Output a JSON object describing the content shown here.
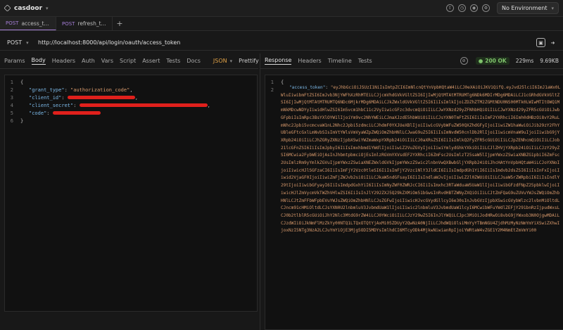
{
  "app": {
    "title": "casdoor"
  },
  "environment": {
    "label": "No Environment"
  },
  "tabs": [
    {
      "method": "POST",
      "name": "access_t..."
    },
    {
      "method": "POST",
      "name": "refresh_t..."
    }
  ],
  "tab_add": "+",
  "request": {
    "method": "POST",
    "url": "http://localhost:8000/api/login/oauth/access_token"
  },
  "request_tabs": [
    "Params",
    "Body",
    "Headers",
    "Auth",
    "Vars",
    "Script",
    "Assert",
    "Tests",
    "Docs"
  ],
  "body_mode": "JSON",
  "prettify": "Prettify",
  "body_lines": [
    {
      "n": "1",
      "t": "{"
    },
    {
      "n": "2",
      "key": "\"grant_type\"",
      "val": "\"authorization_code\""
    },
    {
      "n": "3",
      "key": "\"client_id\""
    },
    {
      "n": "4",
      "key": "\"client_secret\""
    },
    {
      "n": "5",
      "key": "\"code\""
    },
    {
      "n": "6",
      "t": "}"
    }
  ],
  "response_tabs": [
    "Response",
    "Headers",
    "Timeline",
    "Tests"
  ],
  "status": {
    "text": "200 OK",
    "time": "229ms",
    "size": "9.69KB",
    "color": "#7fc36b"
  },
  "response": {
    "line1": "{",
    "key": "\"access_token\"",
    "token": "\"eyJhbGciOiJSUzI1NiIsImtpZCI6ImNlcnQtYnVpbHQtaW4iLCJ0eXAiOiJKV1QifQ.eyJvd25lciI6ImJ1aWx0LWluIiwibmFtZSI6ImJvb3NjYWFhXzRhMTEiLCJjcmVhdGVkVGltZSI6IjIwMjQtMTAtMTRUMTg6NDk6MDIrMDg6MDAiLCJ1cGRhdGVkVGltZSI6IjIwMjQtMTAtMTRUMTQ6NDc6MjkrMDg6MDAiLCJkZWxldGVkVGltZSI6IiIsImlkIjoiZDZhZTM2ZGMtNDU0NS00MTk0LWIwMTItOWQ1MmNkMDcwNDYyIiwidHlwZSI6Im5vcm1hbC11c2VyIiwicGFzc3dvcmQiOiIiLCJwYXNzd29yZFNhbHQiOiIiLCJwYXNzd29yZFR5cGUiOiJwbGFpbiIsImRpc3BsYXlOYW1lIjoiYm9vc2NhYWEiLCJmaXJzdE5hbWUiOiIiLCJsYXN0TmFtZSI6IiIsImF2YXRhciI6Imh0dHBzOi8vY2RuLmNhc2Jpbi5vcmcvaW1nL2Nhc2Jpbi5zdmciLCJhdmF0YXJUeXBlIjoiIiwicGVybWFuZW50QXZhdGFyIjoiIiwiZW1haWwiOiJib29zY2FhYUBleGFtcGxlLmNvbSIsImVtYWlsVmVyaWZpZWQiOmZhbHNlLCJwaG9uZSI6IiIsImNvdW50cnlDb2RlIjoiIiwicmVnaW9uIjoiIiwibG9jYXRpb24iOiIiLCJhZGRyZXNzIjpbXSwiYWZmaWxpYXRpb24iOiIiLCJ0aXRsZSI6IiIsImlkQ2FyZFR5cGUiOiIiLCJpZENhcmQiOiIiLCJob21lcGFnZSI6IiIsImJpbyI6IiIsImxhbmd1YWdlIjoiIiwiZ2VuZGVyIjoiIiwiYmlydGhkYXkiOiIiLCJlZHVjYXRpb24iOiIiLCJzY29yZSI6MCwia2FybWEiOjAsInJhbmtpbmciOjEsImlzRGVmYXVsdEF2YXRhciI6ZmFsc2UsImlzT25saW5lIjpmYWxzZSwiaXNBZG1pbiI6ZmFsc2UsImlzRm9yYmlkZGVuIjpmYWxzZSwiaXNEZWxldGVkIjpmYWxzZSwic2lnbnVwQXBwbGljYXRpb24iOiJhcHAtYnVpbHQtaW4iLCJoYXNoIjoiIiwicHJlSGFzaCI6IiIsImFjY2Vzc0tleSI6IiIsImFjY2Vzc1NlY3JldCI6IiIsImdpdGh1YiI6IiIsImdvb2dsZSI6IiIsInFxIjoiIiwid2VjaGF0IjoiIiwiZmFjZWJvb2siOiIiLCJkaW5ndGFsayI6IiIsIndlaWJvIjoiIiwiZ2l0ZWUiOiIiLCJsaW5rZWRpbiI6IiIsIndlY29tIjoiIiwibGFyayI6IiIsImdpdGxhYiI6IiIsImNyZWF0ZWRJcCI6IiIsImxhc3RTaWduaW5UaW1lIjoiIiwibGFzdFNpZ25pbklwIjoiIiwicHJlZmVycmVkTWZhVHlwZSI6IiIsInJlY292ZXJ5Q29kZXMiOm51bGwsInRvdHBTZWNyZXQiOiIiLCJtZmFQaG9uZUVuYWJsZWQiOmZhbHNlLCJtZmFFbWFpbEVuYWJsZWQiOmZhbHNlLCJsZGFwIjoiIiwicHJvcGVydGllcyI6e30sInJvbGVzIjpbXSwicGVybWlzc2lvbnMiOltdLCJncm91cHMiOltdLCJsYXN0U2lnbmluV3JvbmdUaW1lIjoiIiwic2lnbmluV3JvbmdUaW1lcyI6MCwibWFuYWdlZEFjY291bnRzIjpudWxsLCJ0b2tlblR5cGUiOiJhY2Nlc3MtdG9rZW4iLCJ0YWciOiIiLCJzY29wZSI6InJlYWQiLCJpc3MiOiJodHRwOi8vbG9jYWxob3N0OjgwMDAiLCJzdWIiOiJkNmFlMzZkYy00NTQ1LTQxOTQtYjAxMi05ZDUyY2QwNzA0NjIiLCJhdWQiOlsiMmYyYTBmNGU4ZjdhMzMyNzNmYmYiXSwiZXhwIjoxNzI5NTg3NzA2LCJuYmYiOjE3Mjg5ODI5MDYsImlhdCI6MTcyODk4MjkwNiwianRpIjoiYWRtaW4vZGE1Y2M4NmEtZmVmYi00"
  }
}
